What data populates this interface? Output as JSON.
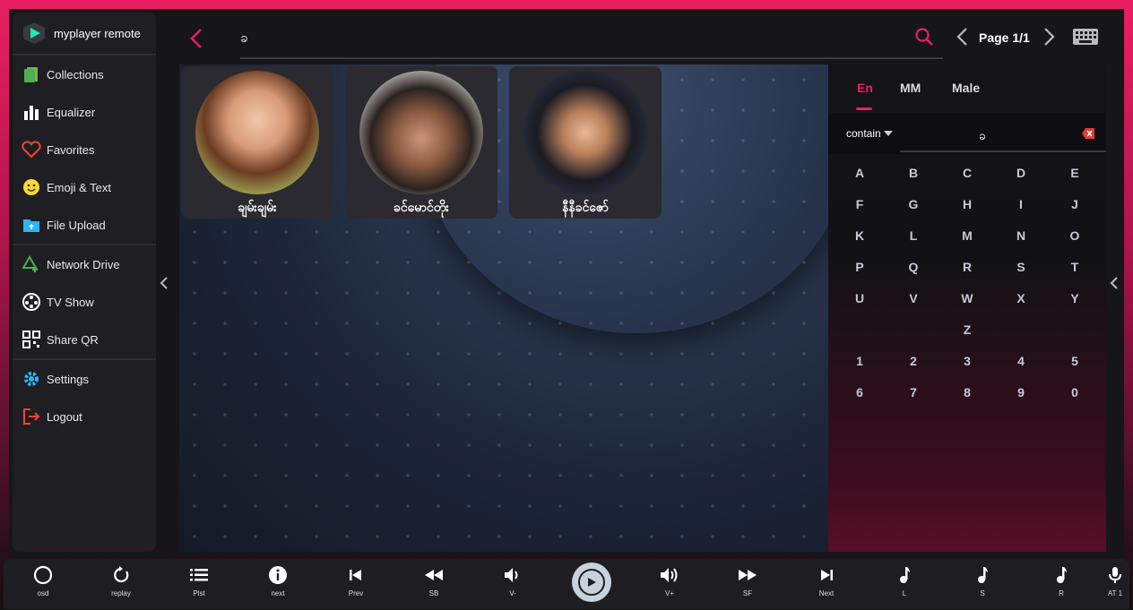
{
  "app": {
    "title": "myplayer remote"
  },
  "sidebar": {
    "items": [
      {
        "label": "Collections",
        "icon": "collections-icon"
      },
      {
        "label": "Equalizer",
        "icon": "equalizer-icon"
      },
      {
        "label": "Favorites",
        "icon": "heart-icon"
      },
      {
        "label": "Emoji & Text",
        "icon": "emoji-icon"
      },
      {
        "label": "File Upload",
        "icon": "folder-upload-icon"
      },
      {
        "label": "Network Drive",
        "icon": "network-drive-icon"
      },
      {
        "label": "TV Show",
        "icon": "tv-show-icon"
      },
      {
        "label": "Share QR",
        "icon": "qr-code-icon"
      },
      {
        "label": "Settings",
        "icon": "gear-icon"
      },
      {
        "label": "Logout",
        "icon": "logout-icon"
      }
    ]
  },
  "search": {
    "value": "ခ"
  },
  "pager": {
    "label": "Page 1/1"
  },
  "artists": [
    {
      "name": "ချမ်းချမ်း"
    },
    {
      "name": "ခင်မောင်တိုး"
    },
    {
      "name": "နီနီခင်ဇော်"
    }
  ],
  "keyboard": {
    "tabs": [
      "En",
      "MM",
      "Male"
    ],
    "active_tab": "En",
    "mode": "contain",
    "input": "ခ",
    "rows": [
      [
        "A",
        "B",
        "C",
        "D",
        "E"
      ],
      [
        "F",
        "G",
        "H",
        "I",
        "J"
      ],
      [
        "K",
        "L",
        "M",
        "N",
        "O"
      ],
      [
        "P",
        "Q",
        "R",
        "S",
        "T"
      ],
      [
        "U",
        "V",
        "W",
        "X",
        "Y"
      ],
      [
        "",
        "",
        "Z",
        "",
        ""
      ],
      [
        "1",
        "2",
        "3",
        "4",
        "5"
      ],
      [
        "6",
        "7",
        "8",
        "9",
        "0"
      ]
    ]
  },
  "bottombar": {
    "buttons": [
      {
        "label": "osd",
        "icon": "osd-icon"
      },
      {
        "label": "replay",
        "icon": "replay-icon"
      },
      {
        "label": "Plst",
        "icon": "playlist-icon"
      },
      {
        "label": "next",
        "icon": "info-icon"
      },
      {
        "label": "Prev",
        "icon": "skip-previous-icon"
      },
      {
        "label": "SB",
        "icon": "rewind-icon"
      },
      {
        "label": "V-",
        "icon": "volume-down-icon"
      },
      {
        "label": "V+",
        "icon": "volume-up-icon"
      },
      {
        "label": "SF",
        "icon": "fast-forward-icon"
      },
      {
        "label": "Next",
        "icon": "skip-next-icon"
      },
      {
        "label": "L",
        "icon": "music-note-icon"
      },
      {
        "label": "S",
        "icon": "music-note-icon"
      },
      {
        "label": "R",
        "icon": "music-note-icon"
      },
      {
        "label": "AT 1",
        "icon": "microphone-icon"
      }
    ]
  },
  "colors": {
    "accent": "#e91e63",
    "panel": "#1f1e22",
    "background": "#161618"
  }
}
